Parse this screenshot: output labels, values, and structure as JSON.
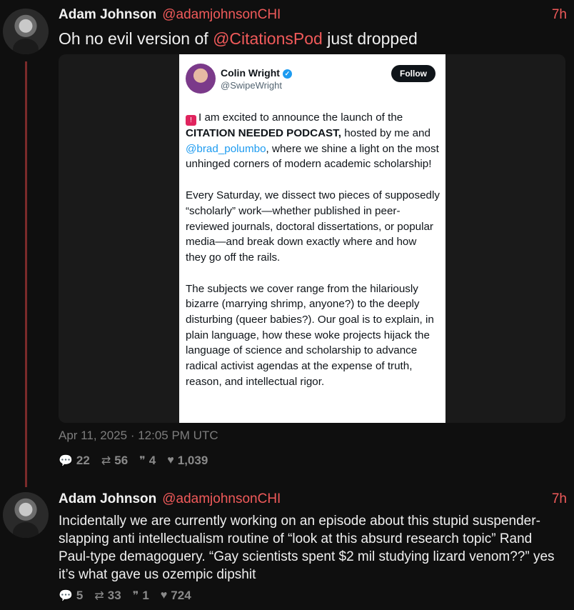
{
  "thread": [
    {
      "author_name": "Adam Johnson",
      "author_handle": "@adamjohnsonCHI",
      "time": "7h",
      "text_before": "Oh no evil version of ",
      "mention": "@CitationsPod",
      "text_after": " just dropped",
      "date": "Apr 11, 2025 · 12:05 PM UTC",
      "stats": {
        "comments": "22",
        "retweets": "56",
        "quotes": "4",
        "likes": "1,039"
      }
    },
    {
      "author_name": "Adam Johnson",
      "author_handle": "@adamjohnsonCHI",
      "time": "7h",
      "text": "Incidentally we are currently working on an episode about this stupid suspender-slapping anti intellectualism routine of “look at this absurd research topic” Rand Paul-type demagoguery. “Gay scientists spent $2 mil studying lizard venom??” yes it’s what gave us ozempic dipshit",
      "stats": {
        "comments": "5",
        "retweets": "33",
        "quotes": "1",
        "likes": "724"
      }
    }
  ],
  "embedded": {
    "name": "Colin Wright",
    "handle": "@SwipeWright",
    "follow_label": "Follow",
    "p1_a": "I am excited to announce the launch of the ",
    "p1_bold": "CITATION NEEDED PODCAST,",
    "p1_b": " hosted by me and ",
    "p1_mention": "@brad_polumbo",
    "p1_c": ", where we shine a light on the most unhinged corners of modern academic scholarship!",
    "p2": "Every Saturday, we dissect two pieces of supposedly “scholarly” work—whether published in peer-reviewed journals, doctoral dissertations, or popular media—and break down exactly where and how they go off the rails.",
    "p3": "The subjects we cover range from the hilariously bizarre (marrying shrimp, anyone?) to the deeply disturbing (queer babies?). Our goal is to explain, in plain language, how these woke projects hijack the language of science and scholarship to advance radical activist agendas at the expense of truth, reason, and intellectual rigor."
  },
  "icons": {
    "comment": "speech-bubble-icon",
    "retweet": "retweet-icon",
    "quote": "quote-icon",
    "like": "heart-icon"
  },
  "colors": {
    "accent": "#f05a5a",
    "background": "#0f0f0f",
    "thread_line": "#7a2a2a"
  }
}
